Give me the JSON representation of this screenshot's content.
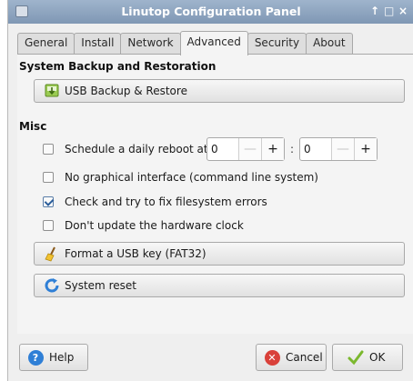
{
  "window": {
    "title": "Linutop Configuration Panel",
    "controls": {
      "pin": "↑",
      "maximize": "□",
      "close": "×"
    }
  },
  "tabs": [
    {
      "label": "General",
      "active": false
    },
    {
      "label": "Install",
      "active": false
    },
    {
      "label": "Network",
      "active": false
    },
    {
      "label": "Advanced",
      "active": true
    },
    {
      "label": "Security",
      "active": false
    },
    {
      "label": "About",
      "active": false
    }
  ],
  "backup": {
    "heading": "System Backup and Restoration",
    "button_label": "USB Backup & Restore",
    "icon": "usb-drive-icon"
  },
  "misc": {
    "heading": "Misc",
    "reboot": {
      "label": "Schedule a daily reboot at",
      "checked": false,
      "hour": "0",
      "minute": "0",
      "separator": ":",
      "minus": "—",
      "plus": "+"
    },
    "options": [
      {
        "label": "No graphical interface (command line system)",
        "checked": false
      },
      {
        "label": "Check and try to fix filesystem errors",
        "checked": true
      },
      {
        "label": "Don't update the hardware clock",
        "checked": false
      }
    ],
    "format_button": "Format a USB key (FAT32)",
    "reset_button": "System reset"
  },
  "footer": {
    "help": "Help",
    "cancel": "Cancel",
    "ok": "OK"
  },
  "colors": {
    "titlebar": "#8ea5c1",
    "help_icon": "#2f7fd6",
    "cancel_icon": "#d9413a",
    "ok_icon": "#7bb82e"
  }
}
